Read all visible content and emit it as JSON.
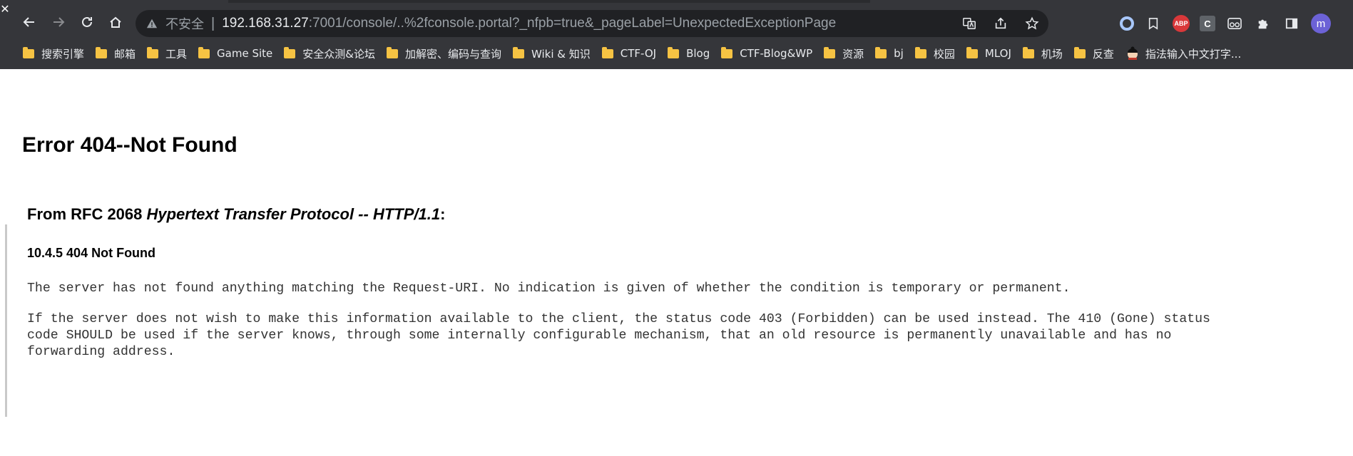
{
  "browser": {
    "close_glyph": "✕",
    "security_label": "不安全",
    "url_host": "192.168.31.27",
    "url_rest": ":7001/console/..%2fconsole.portal?_nfpb=true&_pageLabel=UnexpectedExceptionPage",
    "profile_initial": "m",
    "extensions": [
      "ring-extension-icon",
      "bookmark-icon",
      "adblock-plus-icon",
      "c-extension-icon",
      "glasses-extension-icon",
      "puzzle-icon",
      "sidepanel-icon"
    ],
    "abp_label": "ABP",
    "c_ext_label": "C"
  },
  "bookmarks": [
    {
      "label": "搜索引擎",
      "icon": "folder-icon"
    },
    {
      "label": "邮箱",
      "icon": "folder-icon"
    },
    {
      "label": "工具",
      "icon": "folder-icon"
    },
    {
      "label": "Game Site",
      "icon": "folder-icon"
    },
    {
      "label": "安全众测&论坛",
      "icon": "folder-icon"
    },
    {
      "label": "加解密、编码与查询",
      "icon": "folder-icon"
    },
    {
      "label": "Wiki & 知识",
      "icon": "folder-icon"
    },
    {
      "label": "CTF-OJ",
      "icon": "folder-icon"
    },
    {
      "label": "Blog",
      "icon": "folder-icon"
    },
    {
      "label": "CTF-Blog&WP",
      "icon": "folder-icon"
    },
    {
      "label": "资源",
      "icon": "folder-icon"
    },
    {
      "label": "bj",
      "icon": "folder-icon"
    },
    {
      "label": "校园",
      "icon": "folder-icon"
    },
    {
      "label": "MLOJ",
      "icon": "folder-icon"
    },
    {
      "label": "机场",
      "icon": "folder-icon"
    },
    {
      "label": "反查",
      "icon": "folder-icon"
    },
    {
      "label": "指法输入中文打字...",
      "icon": "avatar-face-icon"
    }
  ],
  "page": {
    "error_title": "Error 404--Not Found",
    "rfc_prefix": "From RFC 2068 ",
    "rfc_title": "Hypertext Transfer Protocol -- HTTP/1.1",
    "rfc_suffix": ":",
    "section_title": "10.4.5 404 Not Found",
    "para1": "The server has not found anything matching the Request-URI. No indication is given of whether the condition is temporary or permanent.",
    "para2": "If the server does not wish to make this information available to the client, the status code 403 (Forbidden) can be used instead. The 410 (Gone) status\ncode SHOULD be used if the server knows, through some internally configurable mechanism, that an old resource is permanently unavailable and has no\nforwarding address."
  },
  "colors": {
    "chrome_bg": "#35363a",
    "omnibox_bg": "#202124",
    "folder": "#f6c343",
    "abp": "#d9383a",
    "profile": "#6c62d6"
  }
}
